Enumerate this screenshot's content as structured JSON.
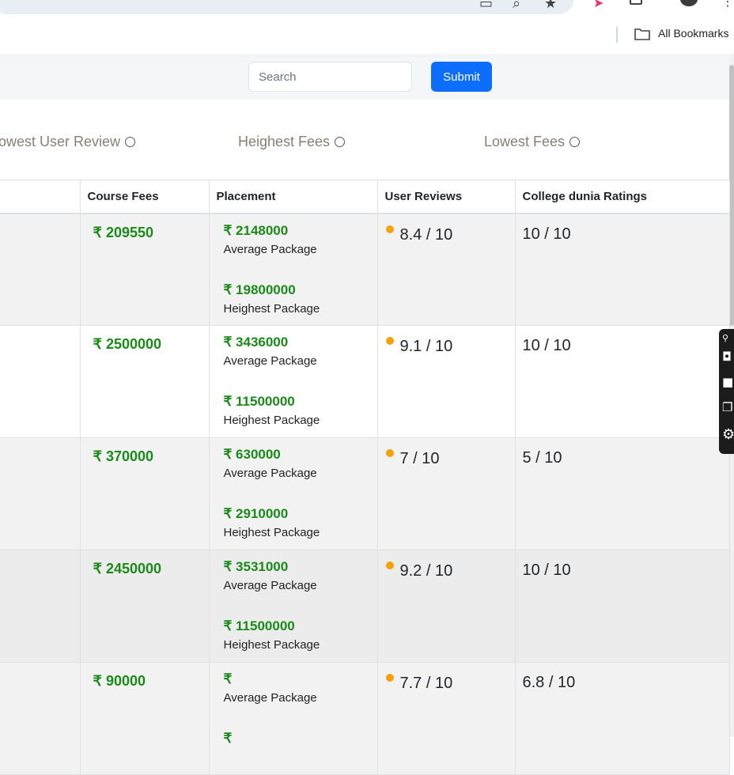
{
  "bookmarks_bar": {
    "all_bookmarks_label": "All Bookmarks"
  },
  "search": {
    "placeholder": "Search",
    "submit_label": "Submit"
  },
  "sort_options": [
    {
      "label": "owest User Review"
    },
    {
      "label": "Heighest Fees"
    },
    {
      "label": "Lowest Fees"
    }
  ],
  "table": {
    "headers": [
      "Course Fees",
      "Placement",
      "User Reviews",
      "College dunia Ratings"
    ],
    "rows": [
      {
        "fee": "₹ 209550",
        "avg": "₹ 2148000",
        "avg_label": "Average Package",
        "high": "₹ 19800000",
        "high_label": "Heighest Package",
        "review": "8.4 / 10",
        "rating": "10 / 10"
      },
      {
        "fee": "₹ 2500000",
        "avg": "₹ 3436000",
        "avg_label": "Average Package",
        "high": "₹ 11500000",
        "high_label": "Heighest Package",
        "review": "9.1 / 10",
        "rating": "10 / 10"
      },
      {
        "fee": "₹ 370000",
        "avg": "₹ 630000",
        "avg_label": "Average Package",
        "high": "₹ 2910000",
        "high_label": "Heighest Package",
        "review": "7 / 10",
        "rating": "5 / 10"
      },
      {
        "fee": "₹ 2450000",
        "avg": "₹ 3531000",
        "avg_label": "Average Package",
        "high": "₹ 11500000",
        "high_label": "Heighest Package",
        "review": "9.2 / 10",
        "rating": "10 / 10"
      },
      {
        "fee": "₹ 90000",
        "avg": "₹",
        "avg_label": "Average Package",
        "high": "₹",
        "high_label": "",
        "review": "7.7 / 10",
        "rating": "6.8 / 10"
      }
    ]
  },
  "colors": {
    "accent": "#0d6efd",
    "money_green": "#1a8a1a",
    "review_dot": "#f5a20a"
  }
}
